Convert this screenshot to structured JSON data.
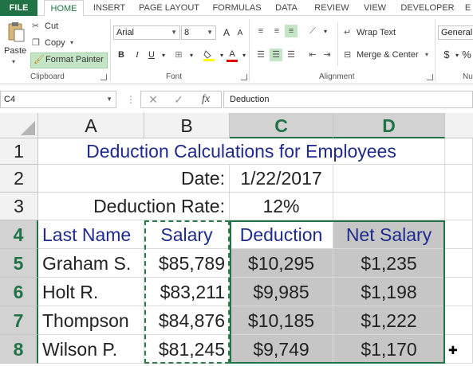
{
  "ribbon_tabs": [
    "FILE",
    "HOME",
    "INSERT",
    "PAGE LAYOUT",
    "FORMULAS",
    "DATA",
    "REVIEW",
    "VIEW",
    "DEVELOPER",
    "E"
  ],
  "clipboard": {
    "paste_label": "Paste",
    "cut_label": "Cut",
    "copy_label": "Copy",
    "format_painter_label": "Format Painter",
    "group_label": "Clipboard"
  },
  "font": {
    "family": "Arial",
    "size": "8",
    "bold": "B",
    "italic": "I",
    "underline": "U",
    "grow": "A",
    "shrink": "A",
    "font_color": "A",
    "group_label": "Font"
  },
  "alignment": {
    "wrap_text_label": "Wrap Text",
    "merge_center_label": "Merge & Center",
    "group_label": "Alignment"
  },
  "number": {
    "format": "General",
    "currency_symbol": "$",
    "percent_symbol": "%",
    "group_label": "Nu"
  },
  "formula_bar": {
    "name_box": "C4",
    "fx_label": "fx",
    "content": "Deduction"
  },
  "columns": [
    "A",
    "B",
    "C",
    "D"
  ],
  "rows": [
    "1",
    "2",
    "3",
    "4",
    "5",
    "6",
    "7",
    "8"
  ],
  "sheet": {
    "title": "Deduction Calculations for Employees",
    "date_label": "Date:",
    "date_value": "1/22/2017",
    "rate_label": "Deduction Rate:",
    "rate_value": "12%",
    "headers": [
      "Last Name",
      "Salary",
      "Deduction",
      "Net Salary"
    ],
    "data": [
      [
        "Graham S.",
        "$85,789",
        "$10,295",
        "$1,235"
      ],
      [
        "Holt R.",
        "$83,211",
        "$9,985",
        "$1,198"
      ],
      [
        "Thompson",
        "$84,876",
        "$10,185",
        "$1,222"
      ],
      [
        "Wilson P.",
        "$81,245",
        "$9,749",
        "$1,170"
      ]
    ]
  },
  "colors": {
    "accent_green": "#217346",
    "title_blue": "#1f2b8c",
    "selection_gray": "#c6c6c6"
  }
}
